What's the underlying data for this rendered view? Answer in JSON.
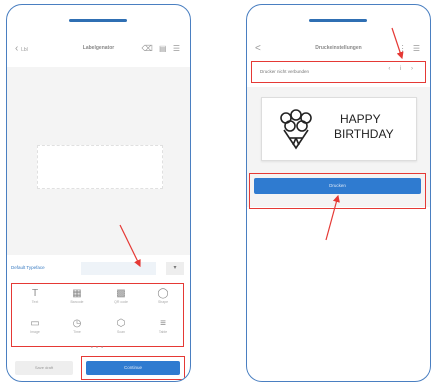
{
  "left_screen": {
    "title": "Labelgenator",
    "back_text": "Lbl",
    "toolbar_icons": "⌫ ▤ ☰",
    "font_label": "Default Typeface",
    "font_button": "▾",
    "tools": [
      {
        "icon": "T",
        "label": "Text"
      },
      {
        "icon": "▦",
        "label": "Barcode"
      },
      {
        "icon": "▩",
        "label": "QR code"
      },
      {
        "icon": "◯",
        "label": "Shape"
      },
      {
        "icon": "▭",
        "label": "Image"
      },
      {
        "icon": "◷",
        "label": "Time"
      },
      {
        "icon": "⬡",
        "label": "Scan"
      },
      {
        "icon": "≡",
        "label": "Table"
      }
    ],
    "secondary_button": "Save draft",
    "primary_button": "Continue",
    "page_dots": "• • •"
  },
  "right_screen": {
    "title": "Druckeinstellungen",
    "back_text": "<",
    "toolbar_icons": "⋮ ☰",
    "printer_name": "Drucker nicht verbunden",
    "printer_icons": "‹ i ›",
    "label_text_line1": "HAPPY",
    "label_text_line2": "BIRTHDAY",
    "print_button": "Drucken"
  },
  "colors": {
    "frame": "#4a7fc1",
    "accent": "#2f7bd0",
    "highlight": "#e53935"
  }
}
